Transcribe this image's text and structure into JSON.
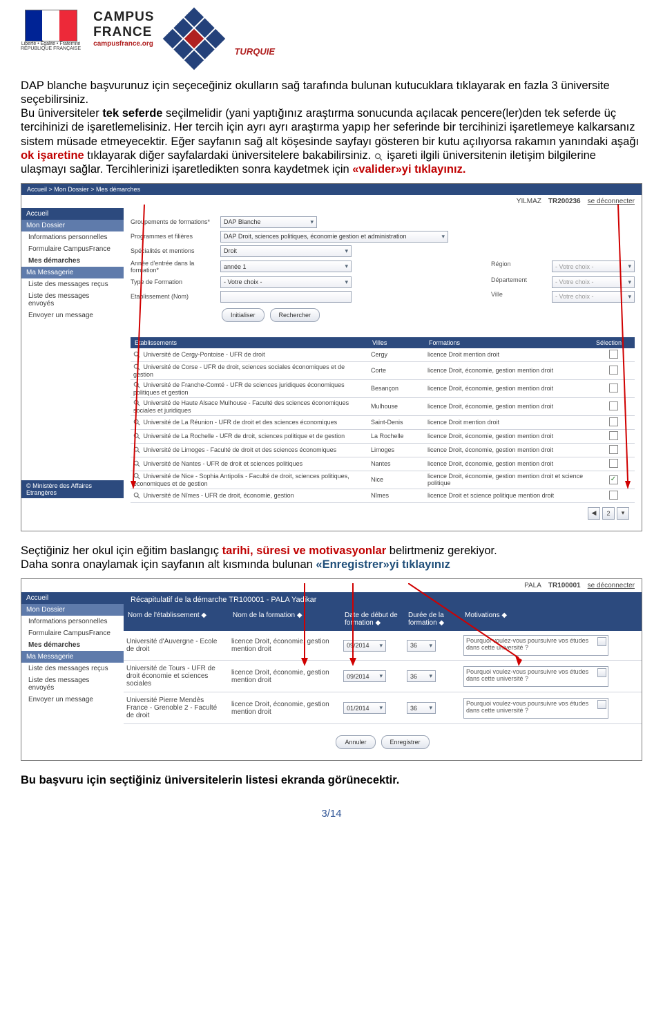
{
  "header": {
    "flag_caption1": "Liberté • Égalité • Fraternité",
    "flag_caption2": "RÉPUBLIQUE FRANÇAISE",
    "logo_line1": "CAMPUS",
    "logo_line2": "FRANCE",
    "logo_url": "campusfrance.org",
    "logo_country": "TURQUIE"
  },
  "para1_a": "DAP blanche başvurunuz için seçeceğiniz okulların sağ tarafında bulunan kutucuklara tıklayarak en fazla 3 üniversite seçebilirsiniz.",
  "para1_b_pre": "Bu üniversiteler ",
  "para1_b_bold": "tek seferde",
  "para1_b_post": " seçilmelidir (yani yaptığınız araştırma sonucunda açılacak pencere(ler)den tek seferde üç tercihinizi de işaretlemelisiniz. Her tercih için ayrı ayrı araştırma yapıp her seferinde bir tercihinizi işaretlemeye kalkarsanız sistem müsade etmeyecektir. Eğer sayfanın sağ alt köşesinde sayfayı gösteren bir kutu açılıyorsa rakamın yanındaki aşağı ",
  "ok_text": "ok işaretine",
  "para1_c": " tıklayarak diğer sayfalardaki üniversitelere bakabilirsiniz. ",
  "para1_d": " işareti ilgili üniversitenin iletişim bilgilerine ulaşmayı sağlar. Tercihlerinizi işaretledikten sonra kaydetmek için ",
  "valider_text": "«valider»yi tıklayınız.",
  "s1": {
    "user": "YILMAZ",
    "id": "TR200236",
    "logout": "se déconnecter",
    "breadcrumb": "Accueil > Mon Dossier > Mes démarches",
    "side": {
      "accueil": "Accueil",
      "dossier": "Mon Dossier",
      "infos": "Informations personnelles",
      "form": "Formulaire CampusFrance",
      "dem": "Mes démarches",
      "msg": "Ma Messagerie",
      "m1": "Liste des messages reçus",
      "m2": "Liste des messages envoyés",
      "m3": "Envoyer un message",
      "gov": "© Ministère des Affaires Etrangères"
    },
    "labels": {
      "grp": "Groupements de formations*",
      "prog": "Programmes et filières",
      "spec": "Spécialités et mentions",
      "annee": "Année d'entrée dans la formation*",
      "type": "Type de Formation",
      "etab": "Etablissement (Nom)",
      "region": "Région",
      "dept": "Département",
      "ville": "Ville",
      "votre": "- Votre choix -"
    },
    "vals": {
      "grp": "DAP Blanche",
      "prog": "DAP Droit, sciences politiques, économie gestion et administration",
      "spec": "Droit",
      "annee": "année 1",
      "type": "- Votre choix -"
    },
    "btn_init": "Initialiser",
    "btn_search": "Rechercher",
    "th": {
      "etab": "Etablissements",
      "ville": "Villes",
      "form": "Formations",
      "sel": "Sélection"
    },
    "rows": [
      {
        "e": "Université de Cergy-Pontoise - UFR de droit",
        "v": "Cergy",
        "f": "licence Droit mention droit",
        "c": false
      },
      {
        "e": "Université de Corse - UFR de droit, sciences sociales économiques et de gestion",
        "v": "Corte",
        "f": "licence Droit, économie, gestion mention droit",
        "c": false
      },
      {
        "e": "Université de Franche-Comté - UFR de sciences juridiques économiques politiques et gestion",
        "v": "Besançon",
        "f": "licence Droit, économie, gestion mention droit",
        "c": false
      },
      {
        "e": "Université de Haute Alsace Mulhouse - Faculté des sciences économiques sociales et juridiques",
        "v": "Mulhouse",
        "f": "licence Droit, économie, gestion mention droit",
        "c": false
      },
      {
        "e": "Université de La Réunion - UFR de droit et des sciences économiques",
        "v": "Saint-Denis",
        "f": "licence Droit mention droit",
        "c": false
      },
      {
        "e": "Université de La Rochelle - UFR de droit, sciences politique et de gestion",
        "v": "La Rochelle",
        "f": "licence Droit, économie, gestion mention droit",
        "c": false
      },
      {
        "e": "Université de Limoges - Faculté de droit et des sciences économiques",
        "v": "Limoges",
        "f": "licence Droit, économie, gestion mention droit",
        "c": false
      },
      {
        "e": "Université de Nantes - UFR de droit et sciences politiques",
        "v": "Nantes",
        "f": "licence Droit, économie, gestion mention droit",
        "c": false
      },
      {
        "e": "Université de Nice - Sophia Antipolis - Faculté de droit, sciences politiques, économiques et de gestion",
        "v": "Nice",
        "f": "licence Droit, économie, gestion mention droit et science politique",
        "c": true
      },
      {
        "e": "Université de Nîmes - UFR de droit, économie, gestion",
        "v": "Nîmes",
        "f": "licence Droit et science politique mention droit",
        "c": false
      }
    ],
    "pager": {
      "prev": "◀",
      "page": "2",
      "next": "▾"
    }
  },
  "para2_a": "Seçtiğiniz her okul için eğitim baslangıç ",
  "para2_red": "tarihi, süresi ve motivasyonlar",
  "para2_b": " belirtmeniz gerekiyor.",
  "para2_c": "Daha sonra onaylamak için sayfanın alt kısmında bulunan ",
  "para2_blue": "«Enregistrer»yi tıklayınız",
  "s2": {
    "user": "PALA",
    "id": "TR100001",
    "logout": "se déconnecter",
    "recap_title": "Récapitulatif de la démarche      TR100001 - PALA Yadikar",
    "th": {
      "etab": "Nom de l'établissement",
      "form": "Nom de la formation",
      "date": "Date de début de formation",
      "duree": "Durée de la formation",
      "motiv": "Motivations"
    },
    "rows": [
      {
        "e": "Université d'Auvergne - Ecole de droit",
        "f": "licence Droit, économie, gestion mention droit",
        "d": "09/2014",
        "du": "36",
        "m": "Pourquoi voulez-vous poursuivre vos études dans cette université ?"
      },
      {
        "e": "Université de Tours - UFR de droit économie et sciences sociales",
        "f": "licence Droit, économie, gestion mention droit",
        "d": "09/2014",
        "du": "36",
        "m": "Pourquoi voulez-vous poursuivre vos études dans cette université ?"
      },
      {
        "e": "Université Pierre Mendès France - Grenoble 2 - Faculté de droit",
        "f": "licence Droit, économie, gestion mention droit",
        "d": "01/2014",
        "du": "36",
        "m": "Pourquoi voulez-vous poursuivre vos études dans cette université ?"
      }
    ],
    "btn_cancel": "Annuler",
    "btn_save": "Enregistrer"
  },
  "para3": "Bu başvuru için seçtiğiniz üniversitelerin listesi ekranda görünecektir.",
  "pagenum": "3/14"
}
